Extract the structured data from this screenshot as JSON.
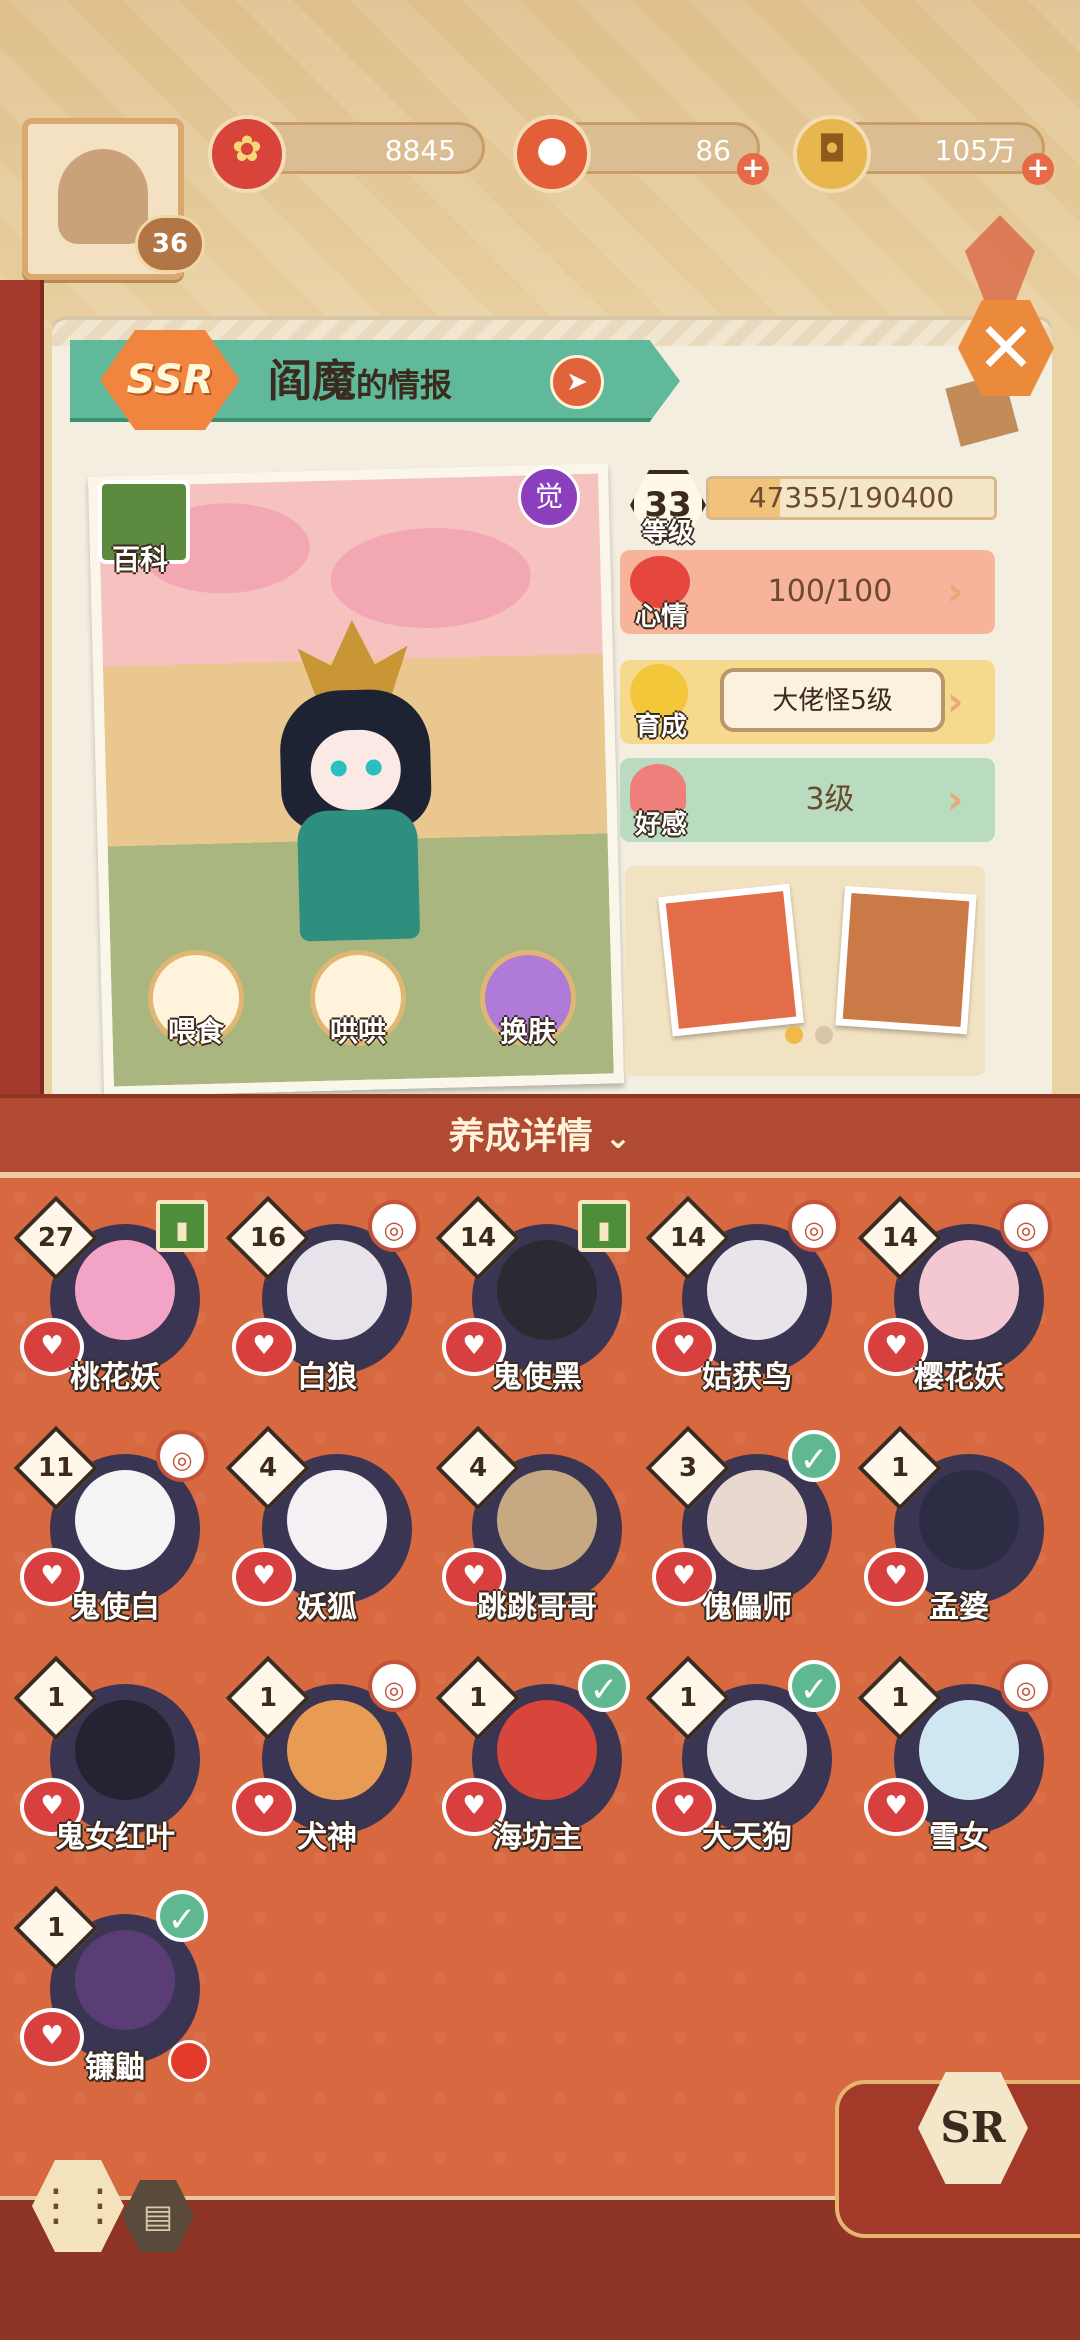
{
  "resources": {
    "food": "8845",
    "jade": "86",
    "coins": "105万"
  },
  "player": {
    "level": "36"
  },
  "header": {
    "rarity": "SSR",
    "name": "阎魔",
    "suffix": "的情报"
  },
  "card": {
    "awaken_badge": "觉",
    "wiki_label": "百科",
    "actions": [
      {
        "label": "喂食"
      },
      {
        "label": "哄哄"
      },
      {
        "label": "换肤"
      }
    ]
  },
  "stats": {
    "level_value": "33",
    "level_label": "等级",
    "exp_text": "47355/190400",
    "exp_progress": 0.249,
    "mood_label": "心情",
    "mood_value": "100/100",
    "growth_label": "育成",
    "growth_value": "大佬怪5级",
    "favor_label": "好感",
    "favor_value": "3级"
  },
  "section": {
    "title": "养成详情"
  },
  "characters": [
    {
      "name": "桃花妖",
      "level": "27",
      "tag": "flag",
      "colors": [
        "#3a3553",
        "#f2a3c6"
      ]
    },
    {
      "name": "白狼",
      "level": "16",
      "tag": "ring",
      "colors": [
        "#3a3553",
        "#e8e3ea"
      ]
    },
    {
      "name": "鬼使黑",
      "level": "14",
      "tag": "flag",
      "colors": [
        "#3a3553",
        "#2a2a33"
      ]
    },
    {
      "name": "姑获鸟",
      "level": "14",
      "tag": "ring",
      "colors": [
        "#3a3553",
        "#e9e4ea"
      ]
    },
    {
      "name": "樱花妖",
      "level": "14",
      "tag": "ring",
      "colors": [
        "#3a3553",
        "#f4c8d3"
      ]
    },
    {
      "name": "鬼使白",
      "level": "11",
      "tag": "ring",
      "colors": [
        "#3a3553",
        "#f4f4f4"
      ]
    },
    {
      "name": "妖狐",
      "level": "4",
      "tag": "",
      "colors": [
        "#3a3553",
        "#f4f0f3"
      ]
    },
    {
      "name": "跳跳哥哥",
      "level": "4",
      "tag": "",
      "colors": [
        "#3a3553",
        "#c6a883"
      ]
    },
    {
      "name": "傀儡师",
      "level": "3",
      "tag": "check",
      "colors": [
        "#3a3553",
        "#e8d8cf"
      ]
    },
    {
      "name": "孟婆",
      "level": "1",
      "tag": "",
      "colors": [
        "#3a3553",
        "#2c2d44"
      ]
    },
    {
      "name": "鬼女红叶",
      "level": "1",
      "tag": "",
      "colors": [
        "#3a3553",
        "#272231"
      ]
    },
    {
      "name": "犬神",
      "level": "1",
      "tag": "ring",
      "colors": [
        "#3a3553",
        "#e89b52"
      ]
    },
    {
      "name": "海坊主",
      "level": "1",
      "tag": "check",
      "colors": [
        "#3a3553",
        "#d8453b"
      ]
    },
    {
      "name": "大天狗",
      "level": "1",
      "tag": "check",
      "colors": [
        "#3a3553",
        "#e5e1e8"
      ]
    },
    {
      "name": "雪女",
      "level": "1",
      "tag": "ring",
      "colors": [
        "#3a3553",
        "#cfe7f2"
      ]
    },
    {
      "name": "镰鼬",
      "level": "1",
      "tag": "check",
      "colors": [
        "#3a3553",
        "#5a3d75"
      ]
    }
  ],
  "bottom": {
    "rarity_filter": "SR"
  },
  "colors": {
    "accent": "#d7683f",
    "header_green": "#5fb99a",
    "mood": "#f8b49a",
    "growth": "#f7d98e",
    "favor": "#b9dcc0"
  }
}
